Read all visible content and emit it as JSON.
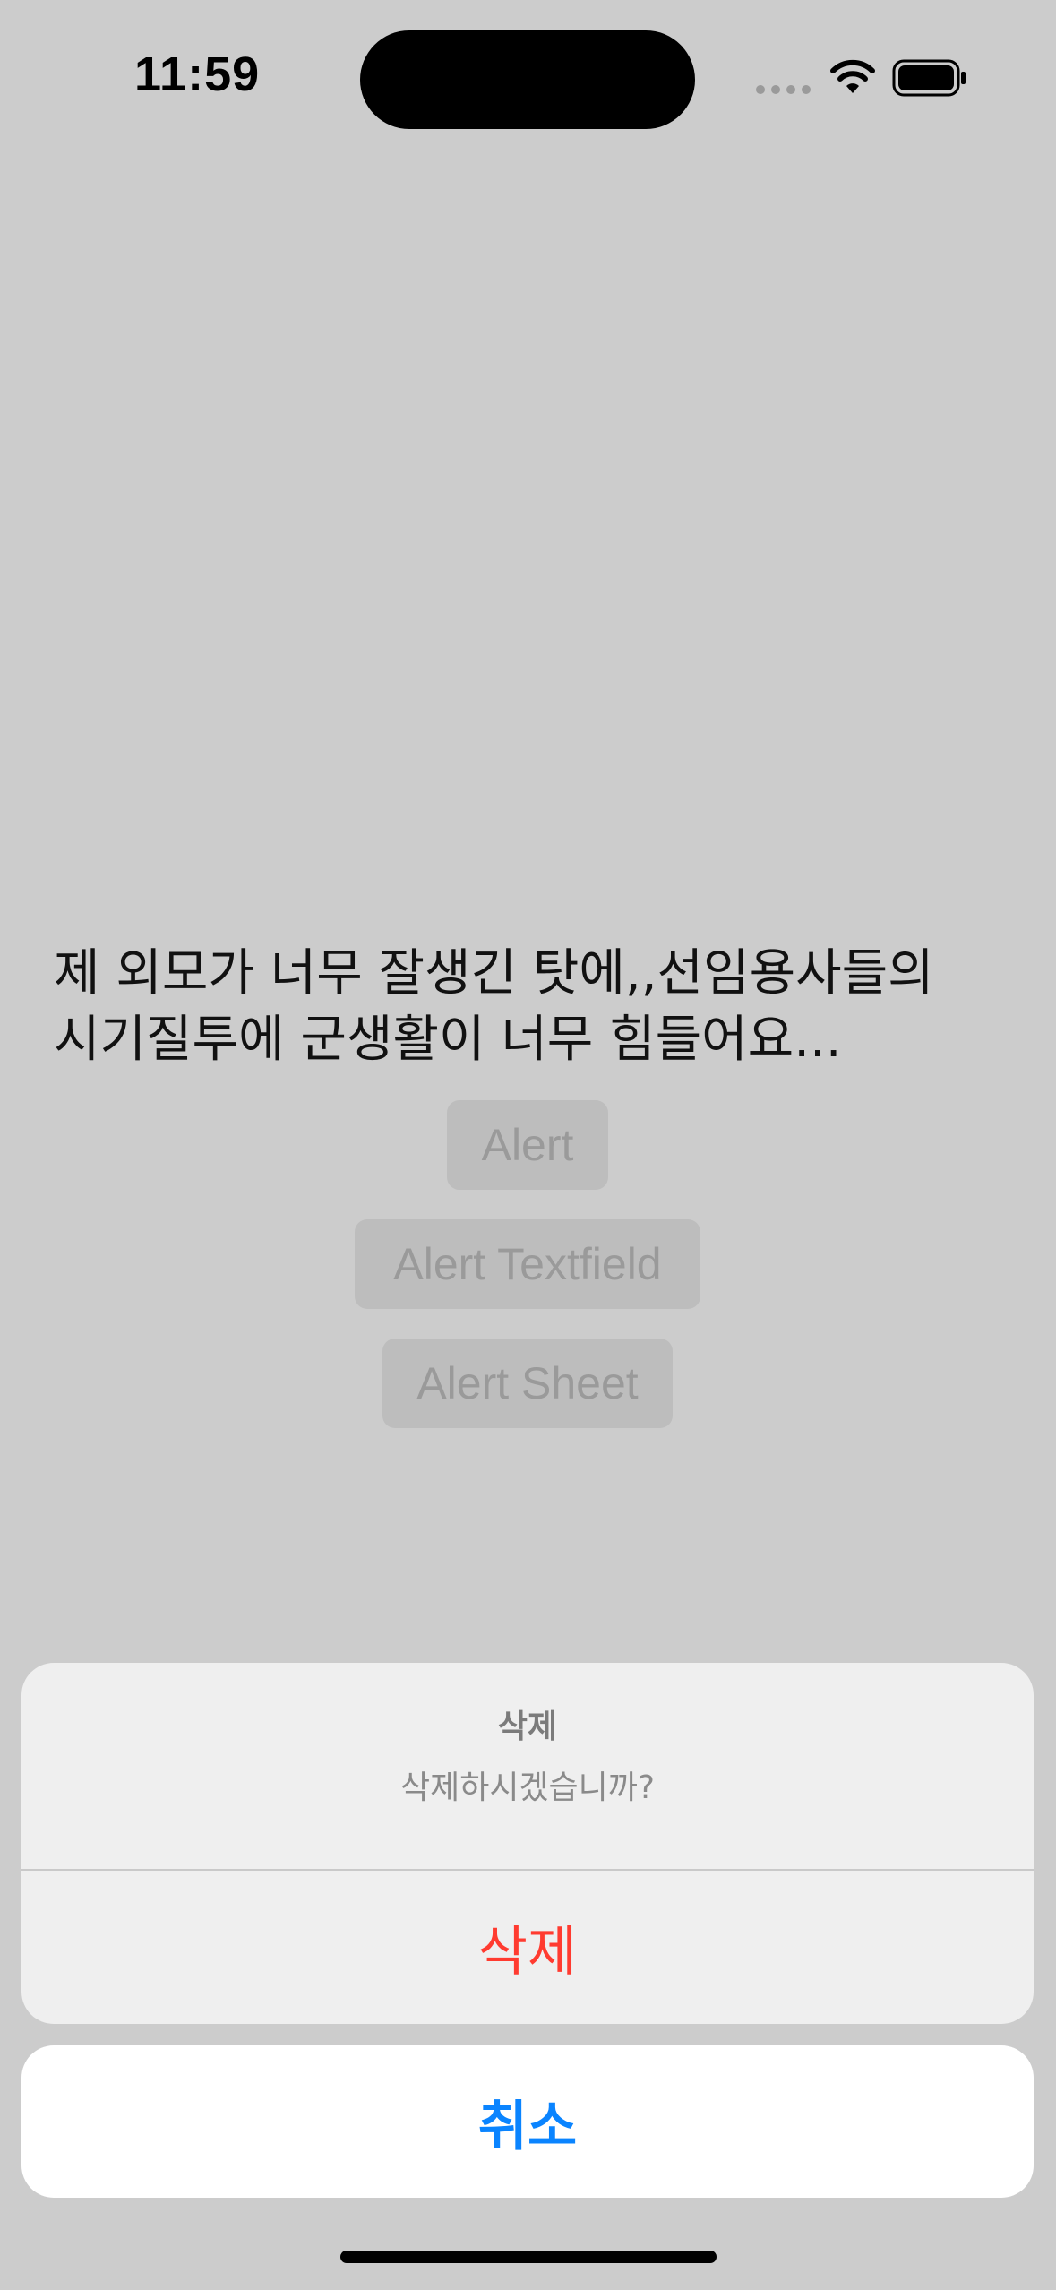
{
  "status_bar": {
    "time": "11:59",
    "icons": [
      "cellular-signal-icon",
      "wifi-icon",
      "battery-icon"
    ]
  },
  "main": {
    "text_line1": "제 외모가 너무 잘생긴 탓에,,선임용사들의",
    "text_line2": "시기질투에 군생활이 너무 힘들어요...",
    "buttons": {
      "alert": "Alert",
      "alert_textfield": "Alert Textfield",
      "alert_sheet": "Alert Sheet"
    }
  },
  "action_sheet": {
    "title": "삭제",
    "message": "삭제하시겠습니까?",
    "delete_label": "삭제",
    "cancel_label": "취소"
  },
  "colors": {
    "destructive": "#ff3b30",
    "accent": "#0a84ff",
    "dim_background": "#cccccc"
  }
}
